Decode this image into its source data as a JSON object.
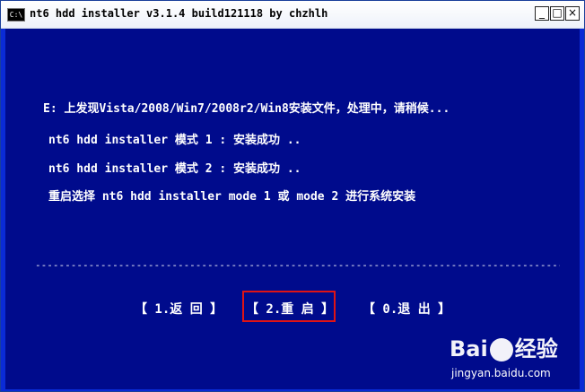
{
  "window": {
    "title": "nt6 hdd installer v3.1.4 build121118 by chzhlh",
    "icon_text": "C:\\",
    "minimize_glyph": "_",
    "maximize_glyph": "□",
    "close_glyph": "×"
  },
  "console": {
    "lines": [
      "E: 上发现Vista/2008/Win7/2008r2/Win8安装文件，处理中，请稍候...",
      "nt6 hdd installer 模式 1 : 安装成功 ..",
      "nt6 hdd installer 模式 2 : 安装成功 ..",
      "重启选择 nt6 hdd installer mode 1 或 mode 2 进行系统安装"
    ],
    "divider": "-----------------------------------------------------------------------------------------------------",
    "menu": {
      "back": "【 1.返 回 】",
      "restart": "【 2.重 启 】",
      "exit": "【 0.退 出 】"
    }
  },
  "watermark": {
    "logo_left": "Bai",
    "logo_right": "经验",
    "url": "jingyan.baidu.com"
  },
  "colors": {
    "console_bg": "#000b8c",
    "highlight": "#e01414",
    "text": "#ffffff"
  }
}
